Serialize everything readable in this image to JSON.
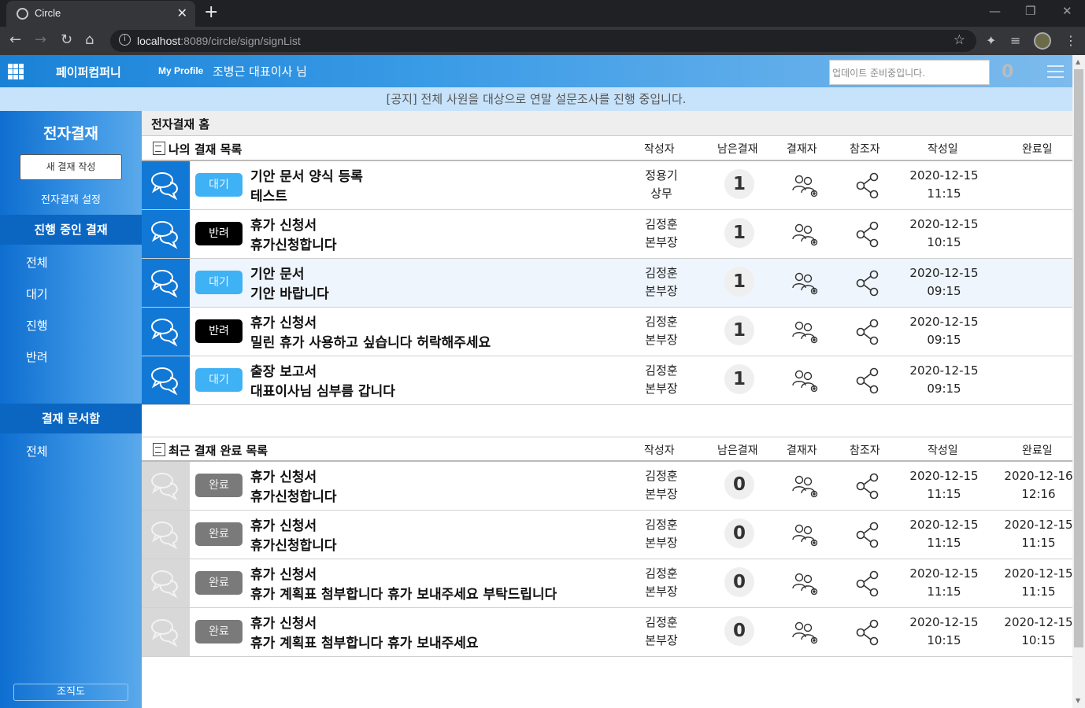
{
  "browser": {
    "tab_title": "Circle",
    "url_host": "localhost",
    "url_rest": ":8089/circle/sign/signList"
  },
  "header": {
    "company": "페이퍼컴퍼니",
    "my_profile": "My Profile",
    "user": "조병근 대표이사 님",
    "search_placeholder": "업데이트 준비중입니다.",
    "notif_count": "0"
  },
  "notice": "[공지] 전체 사원을 대상으로 연말 설문조사를 진행 중입니다.",
  "sidebar": {
    "title": "전자결재",
    "new_button": "새 결재 작성",
    "settings": "전자결재 설정",
    "section_progress": "진행 중인 결재",
    "progress_items": [
      "전체",
      "대기",
      "진행",
      "반려"
    ],
    "section_docs": "결재 문서함",
    "docs_items": [
      "전체"
    ],
    "org_chart": "조직도"
  },
  "main": {
    "title": "전자결재 홈",
    "columns": {
      "author": "작성자",
      "remain": "남은결재",
      "approver": "결재자",
      "reference": "참조자",
      "created": "작성일",
      "completed": "완료일"
    },
    "my_list_title": "나의 결재 목록",
    "my_list": [
      {
        "status": "대기",
        "title": "기안 문서 양식 등록",
        "sub": "테스트",
        "author": "정용기",
        "rank": "상무",
        "remain": "1",
        "date": "2020-12-15",
        "time": "11:15"
      },
      {
        "status": "반려",
        "title": "휴가 신청서",
        "sub": "휴가신청합니다",
        "author": "김정훈",
        "rank": "본부장",
        "remain": "1",
        "date": "2020-12-15",
        "time": "10:15"
      },
      {
        "status": "대기",
        "title": "기안 문서",
        "sub": "기안 바랍니다",
        "author": "김정훈",
        "rank": "본부장",
        "remain": "1",
        "date": "2020-12-15",
        "time": "09:15"
      },
      {
        "status": "반려",
        "title": "휴가 신청서",
        "sub": "밀린 휴가 사용하고 싶습니다 허락해주세요",
        "author": "김정훈",
        "rank": "본부장",
        "remain": "1",
        "date": "2020-12-15",
        "time": "09:15"
      },
      {
        "status": "대기",
        "title": "출장 보고서",
        "sub": "대표이사님 심부름 갑니다",
        "author": "김정훈",
        "rank": "본부장",
        "remain": "1",
        "date": "2020-12-15",
        "time": "09:15"
      }
    ],
    "done_list_title": "최근 결재 완료 목록",
    "done_list": [
      {
        "status": "완료",
        "title": "휴가 신청서",
        "sub": "휴가신청합니다",
        "author": "김정훈",
        "rank": "본부장",
        "remain": "0",
        "date": "2020-12-15",
        "time": "11:15",
        "cdate": "2020-12-16",
        "ctime": "12:16"
      },
      {
        "status": "완료",
        "title": "휴가 신청서",
        "sub": "휴가신청합니다",
        "author": "김정훈",
        "rank": "본부장",
        "remain": "0",
        "date": "2020-12-15",
        "time": "11:15",
        "cdate": "2020-12-15",
        "ctime": "11:15"
      },
      {
        "status": "완료",
        "title": "휴가 신청서",
        "sub": "휴가 계획표 첨부합니다 휴가 보내주세요 부탁드립니다",
        "author": "김정훈",
        "rank": "본부장",
        "remain": "0",
        "date": "2020-12-15",
        "time": "11:15",
        "cdate": "2020-12-15",
        "ctime": "11:15"
      },
      {
        "status": "완료",
        "title": "휴가 신청서",
        "sub": "휴가 계획표 첨부합니다 휴가 보내주세요",
        "author": "김정훈",
        "rank": "본부장",
        "remain": "0",
        "date": "2020-12-15",
        "time": "10:15",
        "cdate": "2020-12-15",
        "ctime": "10:15"
      }
    ]
  }
}
